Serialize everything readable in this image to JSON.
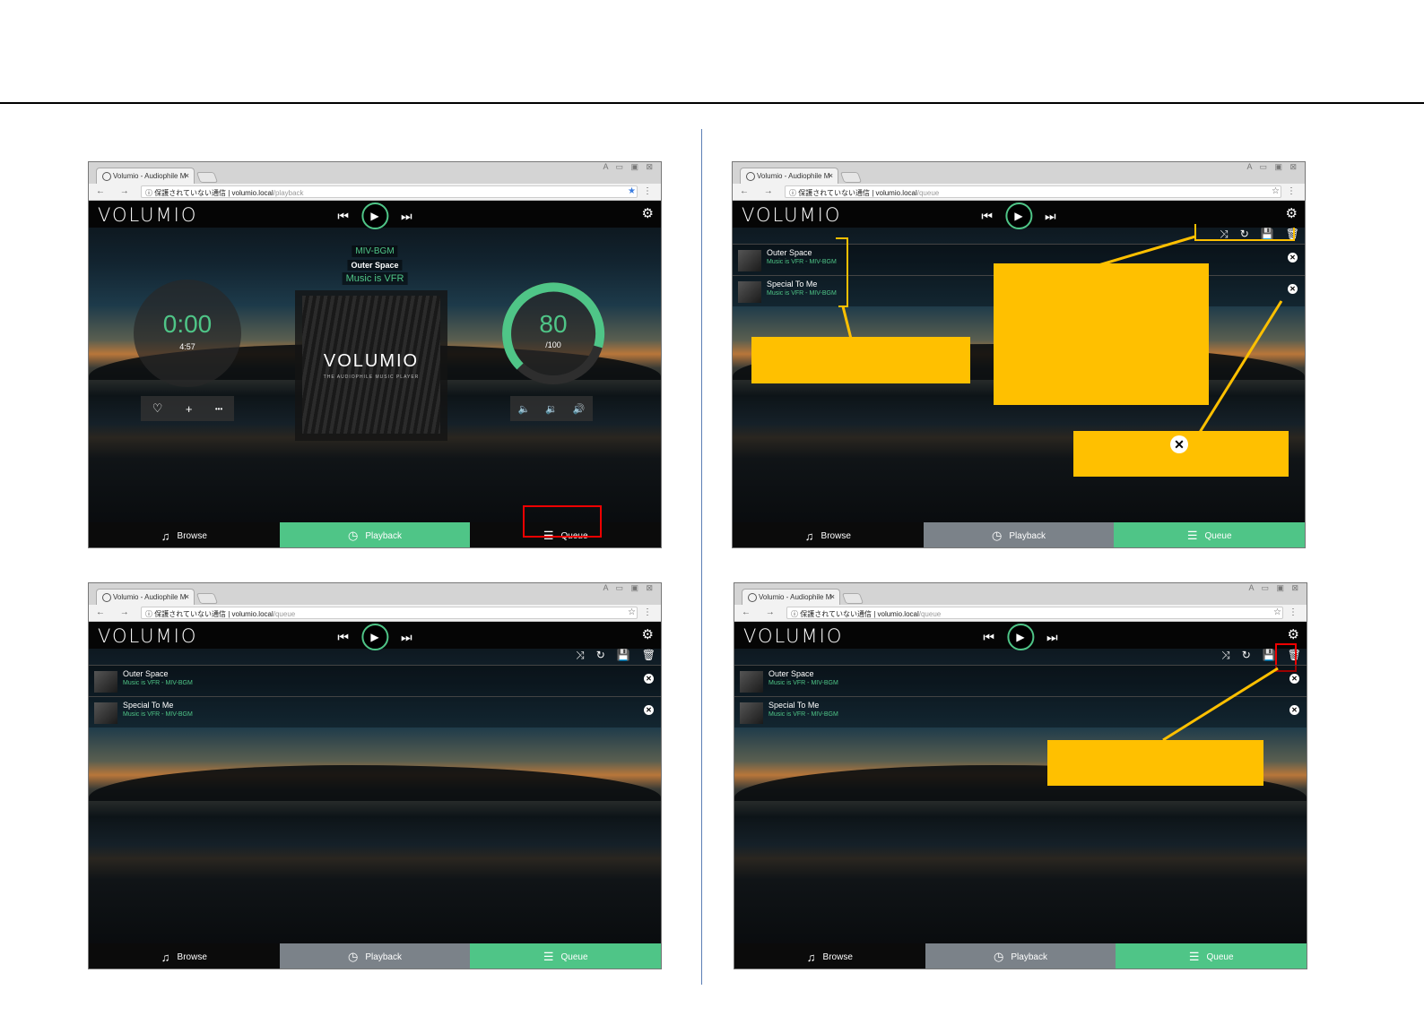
{
  "browser": {
    "tab_title": "Volumio - Audiophile M",
    "tab_close": "×",
    "window_controls": "A ▭ ▣ ⊠",
    "nav": "← → C",
    "url_host": "ⓘ 保護されていない通信 | volumio.local",
    "url_path_playback": "/playback",
    "url_path_queue": "/queue",
    "star": "☆",
    "star_active": "★",
    "menu": "⋮"
  },
  "app": {
    "logo": "VOLUMIO",
    "prev": "⏮",
    "play": "▶",
    "next": "⏭",
    "settings": "⚙",
    "queue_tools": {
      "shuffle": "⤨",
      "repeat": "↻",
      "save": "💾",
      "clear": "🗑"
    }
  },
  "nav": {
    "browse": "Browse",
    "playback": "Playback",
    "queue": "Queue",
    "browse_icon": "♫",
    "playback_icon": "◷",
    "queue_icon": "☰"
  },
  "playback": {
    "album": "MIV-BGM",
    "title": "Outer Space",
    "artist": "Music is VFR",
    "time": "0:00",
    "duration": "4:57",
    "cover_logo": "VOLUMIO",
    "cover_sub": "THE AUDIOPHILE MUSIC PLAYER",
    "volume": "80",
    "volume_max": "/100",
    "fav_icon": "♡",
    "add_icon": "+",
    "more_icon": "•••",
    "vol_mute": "🔈",
    "vol_down": "🔉",
    "vol_up": "🔊"
  },
  "queue": {
    "items": [
      {
        "title": "Outer Space",
        "subtitle": "Music is VFR - MIV-BGM"
      },
      {
        "title": "Special To Me",
        "subtitle": "Music is VFR - MIV-BGM"
      }
    ],
    "remove": "✕"
  },
  "callouts": {
    "x_symbol": "✕"
  },
  "colors": {
    "accent": "#4fc587",
    "callout": "#ffc000",
    "highlight": "#e00000",
    "inactive_tab": "#7b8289"
  }
}
